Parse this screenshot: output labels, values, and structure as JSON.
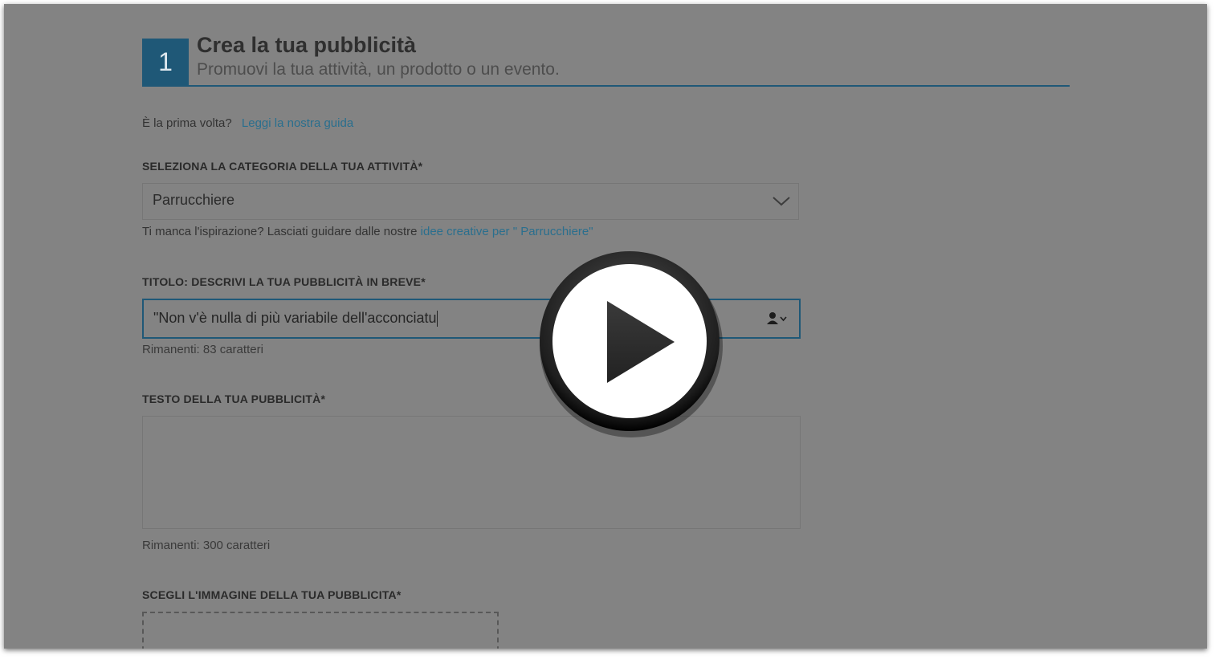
{
  "step": {
    "number": "1",
    "title": "Crea la tua pubblicità",
    "subtitle": "Promuovi la tua attività, un prodotto o un evento."
  },
  "first_time": {
    "question": "È la prima volta?",
    "link": "Leggi la nostra guida"
  },
  "category": {
    "label": "SELEZIONA LA CATEGORIA DELLA TUA ATTIVITÀ*",
    "value": "Parrucchiere",
    "hint_text": "Ti manca l'ispirazione? Lasciati guidare dalle nostre ",
    "hint_link": "idee creative per \" Parrucchiere\""
  },
  "title_field": {
    "label": "TITOLO: DESCRIVI LA TUA PUBBLICITÀ IN BREVE*",
    "value": "\"Non v'è nulla di più variabile dell'acconciatu",
    "remaining": "Rimanenti: 83 caratteri"
  },
  "text_field": {
    "label": "TESTO DELLA TUA PUBBLICITÀ*",
    "value": "",
    "remaining": "Rimanenti: 300 caratteri"
  },
  "image_field": {
    "label": "SCEGLI L'IMMAGINE DELLA TUA PUBBLICITA*"
  },
  "icons": {
    "play": "play-icon",
    "chevron": "chevron-down-icon",
    "person": "person-icon"
  },
  "colors": {
    "overlay_gray": "#838383",
    "accent_blue": "#1f5877",
    "link_blue": "#2a6f8e"
  }
}
